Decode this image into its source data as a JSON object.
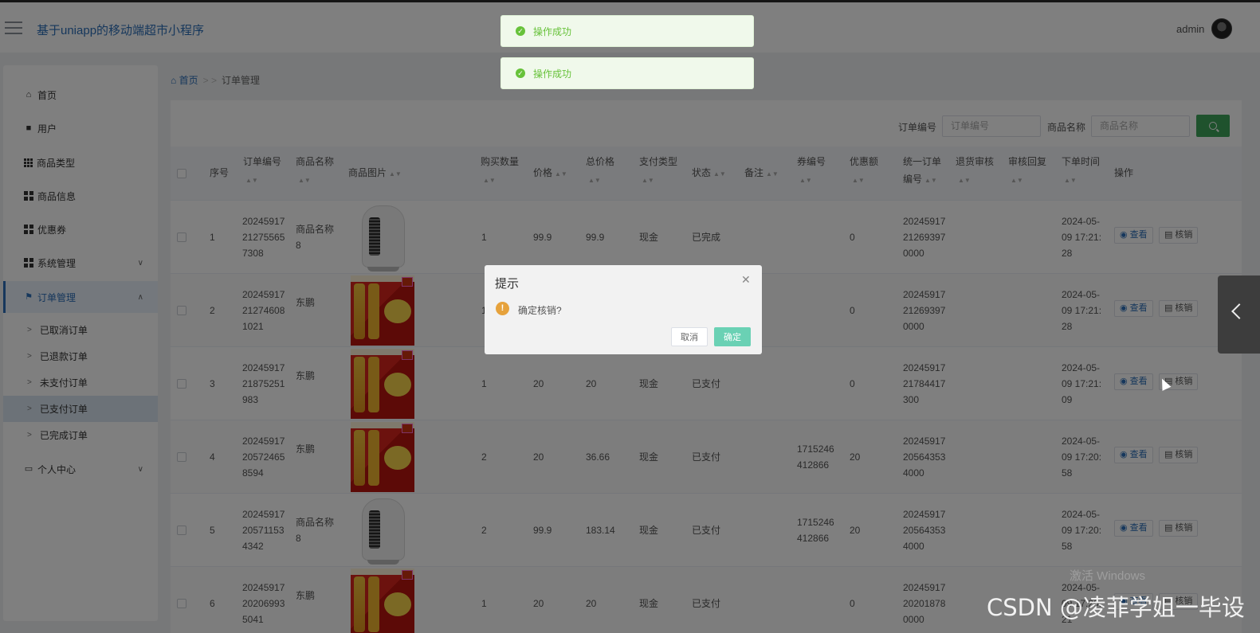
{
  "header": {
    "app_title": "基于uniapp的移动端超市小程序",
    "user_name": "admin"
  },
  "toasts": [
    "操作成功",
    "操作成功"
  ],
  "sidebar": {
    "items": [
      {
        "label": "首页",
        "icon": "home-icon"
      },
      {
        "label": "用户",
        "icon": "monitor-icon"
      },
      {
        "label": "商品类型",
        "icon": "grid-icon"
      },
      {
        "label": "商品信息",
        "icon": "grid-icon"
      },
      {
        "label": "优惠券",
        "icon": "grid-icon"
      },
      {
        "label": "系统管理",
        "icon": "grid-icon"
      },
      {
        "label": "订单管理",
        "icon": "flag-icon"
      },
      {
        "label": "个人中心",
        "icon": "card-icon"
      }
    ],
    "sub_items": [
      "已取消订单",
      "已退款订单",
      "未支付订单",
      "已支付订单",
      "已完成订单"
    ]
  },
  "breadcrumb": {
    "home": "首页",
    "sep": "> >",
    "current": "订单管理"
  },
  "search": {
    "order_no_label": "订单编号",
    "order_no_placeholder": "订单编号",
    "goods_name_label": "商品名称",
    "goods_name_placeholder": "商品名称"
  },
  "table": {
    "headers": {
      "index": "序号",
      "order_no": "订单编号",
      "goods_name": "商品名称",
      "goods_image": "商品图片",
      "qty": "购买数量",
      "price": "价格",
      "total": "总价格",
      "pay_type": "支付类型",
      "status": "状态",
      "remark": "备注",
      "coupon_no": "券编号",
      "discount": "优惠额",
      "unified_order_no": "统一订单编号",
      "refund_review": "退货审核",
      "review_reply": "审核回复",
      "order_time": "下单时间",
      "action": "操作"
    },
    "view_label": "查看",
    "verify_label": "核销",
    "rows": [
      {
        "index": "1",
        "order_no": "20245917212755657308",
        "goods_name": "商品名称8",
        "image": "heater",
        "qty": "1",
        "price": "99.9",
        "total": "99.9",
        "pay_type": "现金",
        "status": "已完成",
        "coupon_no": "",
        "discount": "0",
        "unified": "20245917212693970000",
        "time": "2024-05-09 17:21:28"
      },
      {
        "index": "2",
        "order_no": "20245917212746081021",
        "goods_name": "东鹏",
        "image": "drink",
        "qty": "1",
        "price": "20",
        "total": "20",
        "pay_type": "现金",
        "status": "已完成",
        "coupon_no": "",
        "discount": "0",
        "unified": "20245917212693970000",
        "time": "2024-05-09 17:21:28"
      },
      {
        "index": "3",
        "order_no": "2024591721875251983",
        "goods_name": "东鹏",
        "image": "drink",
        "qty": "1",
        "price": "20",
        "total": "20",
        "pay_type": "现金",
        "status": "已支付",
        "coupon_no": "",
        "discount": "0",
        "unified": "2024591721784417300",
        "time": "2024-05-09 17:21:09"
      },
      {
        "index": "4",
        "order_no": "20245917205724658594",
        "goods_name": "东鹏",
        "image": "drink",
        "qty": "2",
        "price": "20",
        "total": "36.66",
        "pay_type": "现金",
        "status": "已支付",
        "coupon_no": "1715246412866",
        "discount": "20",
        "unified": "20245917205643534000",
        "time": "2024-05-09 17:20:58"
      },
      {
        "index": "5",
        "order_no": "20245917205711534342",
        "goods_name": "商品名称8",
        "image": "heater",
        "qty": "2",
        "price": "99.9",
        "total": "183.14",
        "pay_type": "现金",
        "status": "已支付",
        "coupon_no": "1715246412866",
        "discount": "20",
        "unified": "20245917205643534000",
        "time": "2024-05-09 17:20:58"
      },
      {
        "index": "6",
        "order_no": "20245917202069935041",
        "goods_name": "东鹏",
        "image": "drink",
        "qty": "1",
        "price": "20",
        "total": "20",
        "pay_type": "现金",
        "status": "已支付",
        "coupon_no": "",
        "discount": "0",
        "unified": "20245917202018780000",
        "time": "2024-05-09 17:20:21"
      }
    ]
  },
  "dialog": {
    "title": "提示",
    "message": "确定核销?",
    "cancel_label": "取消",
    "confirm_label": "确定"
  },
  "watermark": "CSDN @凌菲学姐一毕设",
  "windows_mark": "激活 Windows",
  "colors": {
    "primary": "#2c6fb8",
    "success": "#3fa45b",
    "confirm": "#6ad1b4",
    "warning": "#e6a23c"
  }
}
